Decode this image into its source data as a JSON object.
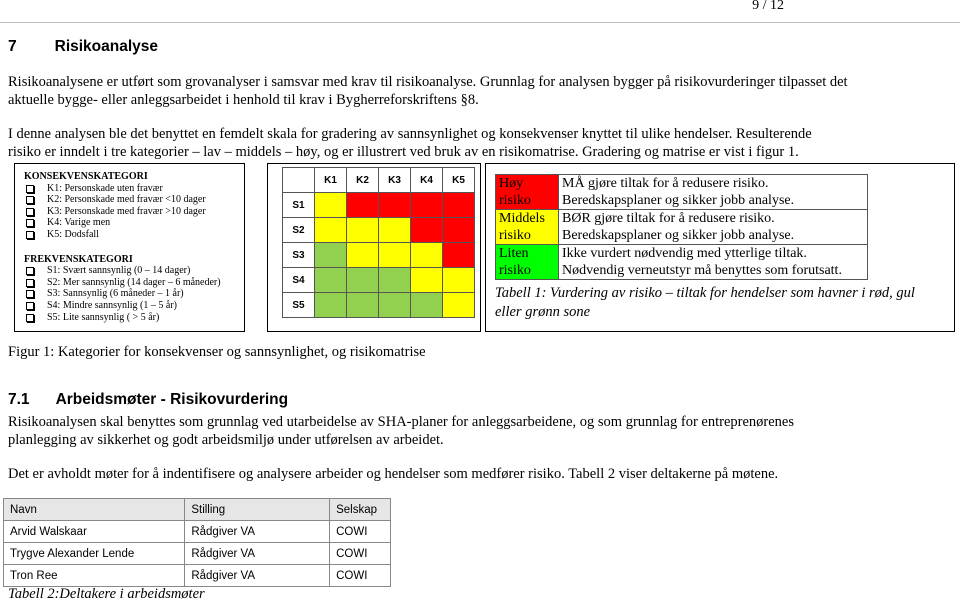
{
  "page_number": "9 / 12",
  "section": {
    "number": "7",
    "title": "Risikoanalyse"
  },
  "paragraphs": [
    "Risikoanalysene er utført som grovanalyser i samsvar med krav til risikoanalyse. Grunnlag for analysen bygger på risikovurderinger tilpasset det aktuelle bygge- eller anleggsarbeidet i henhold til krav i Bygherreforskriftens §8.",
    "I denne analysen ble det benyttet en femdelt skala for gradering av sannsynlighet og konsekvenser knyttet til ulike hendelser. Resulterende risiko er inndelt i tre kategorier – lav – middels – høy, og er illustrert ved bruk av en risikomatrise. Gradering og matrise er vist i figur 1."
  ],
  "categories": {
    "konsekvens_title": "KONSEKVENSKATEGORI",
    "konsekvens": [
      "K1: Personskade uten fravær",
      "K2: Personskade med fravær <10 dager",
      "K3: Personskade med fravær >10 dager",
      "K4: Varige men",
      "K5: Dodsfall"
    ],
    "frekvens_title": "FREKVENSKATEGORI",
    "frekvens": [
      "S1: Svært sannsynlig (0 – 14 dager)",
      "S2: Mer sannsynlig (14 dager – 6 måneder)",
      "S3: Sannsynlig (6 måneder – 1 år)",
      "S4: Mindre sannsynlig (1 – 5 år)",
      "S5: Lite sannsynlig ( > 5 år)"
    ]
  },
  "matrix": {
    "columns": [
      "K1",
      "K2",
      "K3",
      "K4",
      "K5"
    ],
    "rows": [
      "S1",
      "S2",
      "S3",
      "S4",
      "S5"
    ],
    "colors": {
      "R": "#ff0000",
      "Y": "#ffff00",
      "G": "#92d050"
    },
    "cells": [
      [
        "Y",
        "R",
        "R",
        "R",
        "R"
      ],
      [
        "Y",
        "Y",
        "Y",
        "R",
        "R"
      ],
      [
        "G",
        "Y",
        "Y",
        "Y",
        "R"
      ],
      [
        "G",
        "G",
        "G",
        "Y",
        "Y"
      ],
      [
        "G",
        "G",
        "G",
        "G",
        "Y"
      ]
    ]
  },
  "risk_table": {
    "rows": [
      {
        "label": "Høy risiko",
        "text": "MÅ gjøre tiltak for å redusere risiko. Beredskapsplaner og sikker jobb analyse.",
        "color": "#ff0000"
      },
      {
        "label": "Middels risiko",
        "text": "BØR gjøre tiltak for å redusere risiko. Beredskapsplaner og sikker jobb analyse.",
        "color": "#ffff00"
      },
      {
        "label": "Liten risiko",
        "text": "Ikke vurdert nødvendig med ytterlige tiltak. Nødvendig verneutstyr må benyttes som forutsatt.",
        "color": "#00ff00"
      }
    ],
    "caption": "Tabell 1: Vurdering av risiko – tiltak for hendelser som havner i rød, gul eller grønn sone"
  },
  "figure_caption": "Figur 1: Kategorier for konsekvenser og sannsynlighet, og risikomatrise",
  "subsection": {
    "number": "7.1",
    "title": "Arbeidsmøter - Risikovurdering"
  },
  "paragraphs2": [
    "Risikoanalysen skal benyttes som grunnlag ved utarbeidelse av SHA-planer for anleggsarbeidene, og som grunnlag for entreprenørenes planlegging av sikkerhet og godt arbeidsmiljø under utførelsen av arbeidet.",
    "Det er avholdt møter for å indentifisere og analysere arbeider og hendelser som medfører risiko. Tabell 2 viser deltakerne på møtene."
  ],
  "participants": {
    "headers": [
      "Navn",
      "Stilling",
      "Selskap"
    ],
    "rows": [
      [
        "Arvid Walskaar",
        "Rådgiver VA",
        "COWI"
      ],
      [
        "Trygve Alexander Lende",
        "Rådgiver VA",
        "COWI"
      ],
      [
        "Tron Ree",
        "Rådgiver VA",
        "COWI"
      ]
    ],
    "caption": "Tabell 2:Deltakere i arbeidsmøter"
  }
}
